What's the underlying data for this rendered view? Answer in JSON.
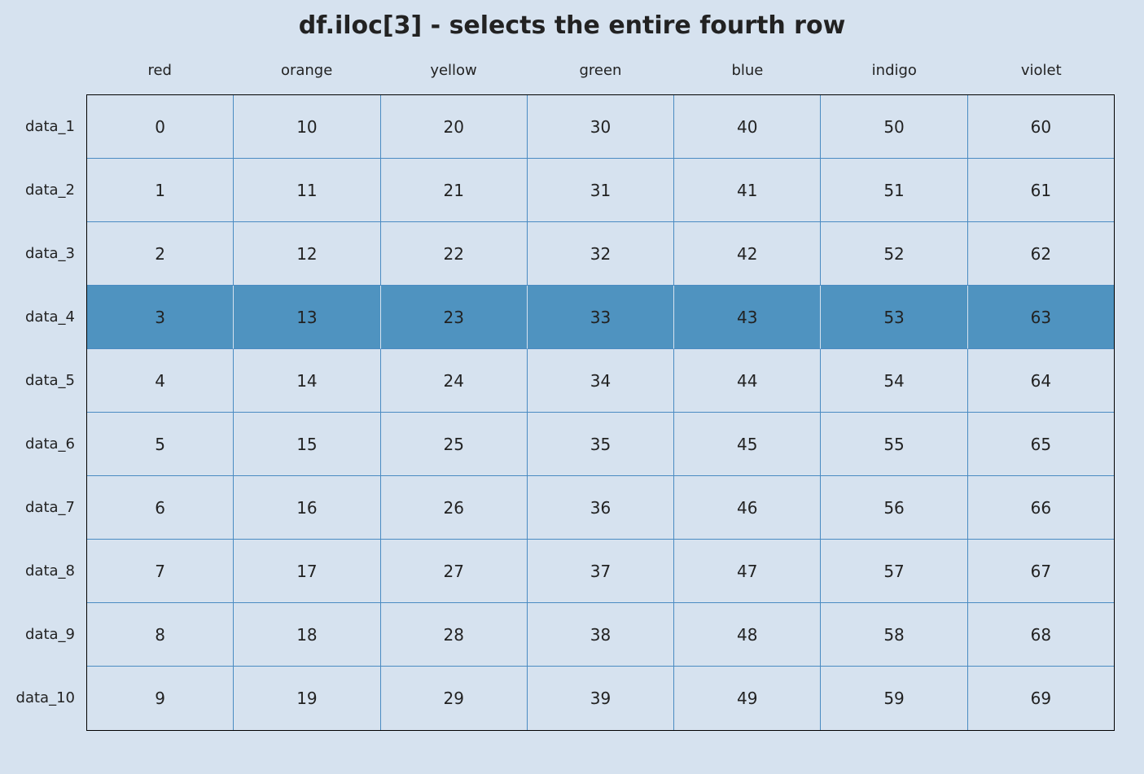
{
  "title": "df.iloc[3] - selects the entire fourth row",
  "chart_data": {
    "type": "table",
    "title": "df.iloc[3] - selects the entire fourth row",
    "columns": [
      "red",
      "orange",
      "yellow",
      "green",
      "blue",
      "indigo",
      "violet"
    ],
    "index": [
      "data_1",
      "data_2",
      "data_3",
      "data_4",
      "data_5",
      "data_6",
      "data_7",
      "data_8",
      "data_9",
      "data_10"
    ],
    "values": [
      [
        0,
        10,
        20,
        30,
        40,
        50,
        60
      ],
      [
        1,
        11,
        21,
        31,
        41,
        51,
        61
      ],
      [
        2,
        12,
        22,
        32,
        42,
        52,
        62
      ],
      [
        3,
        13,
        23,
        33,
        43,
        53,
        63
      ],
      [
        4,
        14,
        24,
        34,
        44,
        54,
        64
      ],
      [
        5,
        15,
        25,
        35,
        45,
        55,
        65
      ],
      [
        6,
        16,
        26,
        36,
        46,
        56,
        66
      ],
      [
        7,
        17,
        27,
        37,
        47,
        57,
        67
      ],
      [
        8,
        18,
        28,
        38,
        48,
        58,
        68
      ],
      [
        9,
        19,
        29,
        39,
        49,
        59,
        69
      ]
    ],
    "highlighted_row_index": 3,
    "colors": {
      "background": "#d6e2ef",
      "grid_line": "#4a8bc2",
      "highlight": "#4f93c0"
    }
  }
}
